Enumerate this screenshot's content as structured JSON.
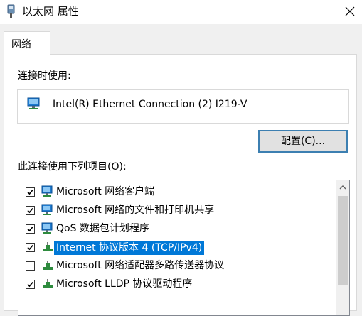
{
  "window": {
    "title": "以太网 属性"
  },
  "tabs": [
    {
      "label": "网络"
    }
  ],
  "connect_using": {
    "label": "连接时使用:",
    "adapter": "Intel(R) Ethernet Connection (2) I219-V",
    "configure_button": "配置(C)..."
  },
  "items_section": {
    "label": "此连接使用下列项目(O):",
    "items": [
      {
        "label": "Microsoft 网络客户端",
        "checked": true,
        "icon": "network-client-icon"
      },
      {
        "label": "Microsoft 网络的文件和打印机共享",
        "checked": true,
        "icon": "file-printer-sharing-icon"
      },
      {
        "label": "QoS 数据包计划程序",
        "checked": true,
        "icon": "qos-scheduler-icon"
      },
      {
        "label": "Internet 协议版本 4 (TCP/IPv4)",
        "checked": true,
        "icon": "protocol-icon",
        "selected": true
      },
      {
        "label": "Microsoft 网络适配器多路传送器协议",
        "checked": false,
        "icon": "protocol-icon"
      },
      {
        "label": "Microsoft LLDP 协议驱动程序",
        "checked": true,
        "icon": "protocol-icon"
      }
    ]
  },
  "colors": {
    "selection": "#0078d7",
    "button_focus_border": "#3c7fb1",
    "protocol_icon_green": "#2e8b3e",
    "network_icon_blue": "#1e7bd0"
  }
}
